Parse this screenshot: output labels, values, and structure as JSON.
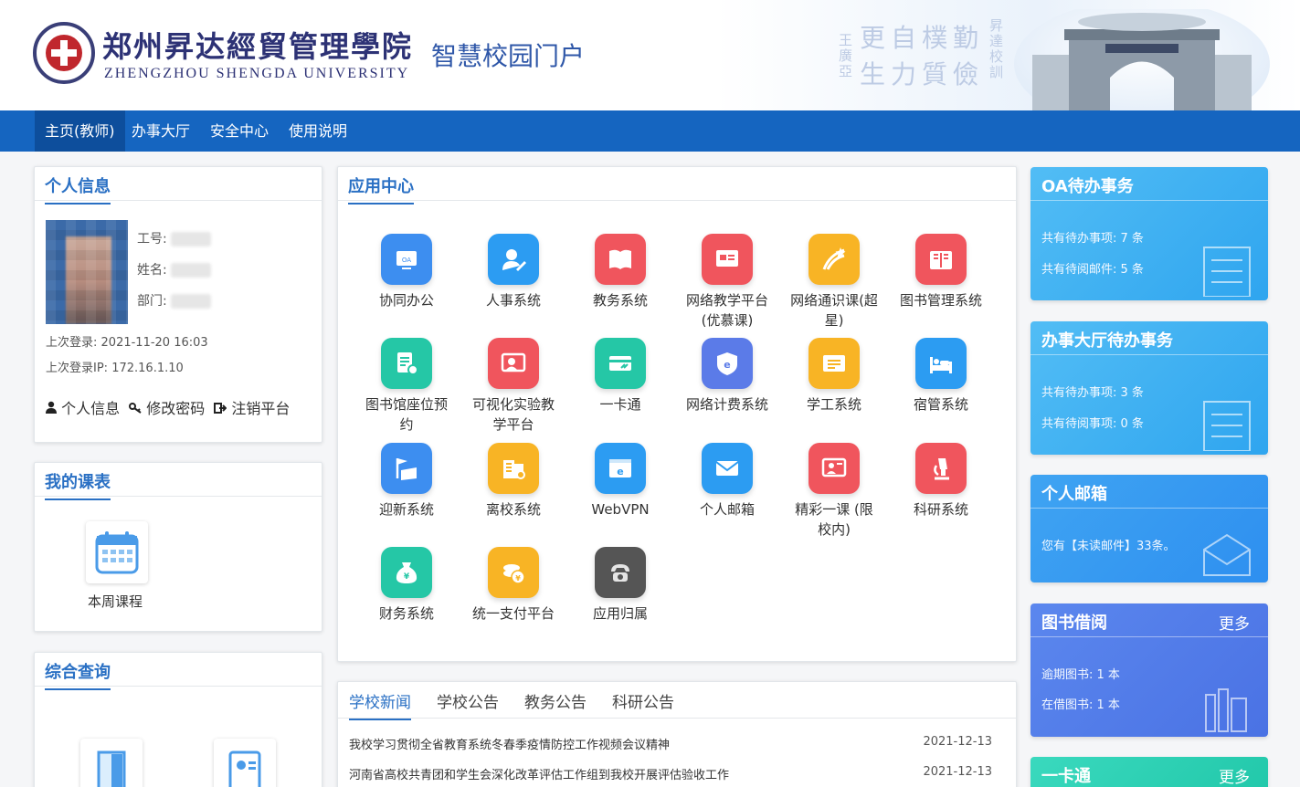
{
  "header": {
    "school_name_cn": "郑州昇达經貿管理學院",
    "school_name_en": "ZHENGZHOU SHENGDA UNIVERSITY",
    "portal_title": "智慧校园门户",
    "motto_main": "更自樸勤",
    "motto_sub": "生力質儉",
    "motto_side_left": "王廣亞",
    "motto_side_right": "昇達校訓"
  },
  "nav": {
    "items": [
      {
        "label": "主页(教师)",
        "active": true
      },
      {
        "label": "办事大厅",
        "active": false
      },
      {
        "label": "安全中心",
        "active": false
      },
      {
        "label": "使用说明",
        "active": false
      }
    ]
  },
  "personal": {
    "title": "个人信息",
    "fields": [
      {
        "label": "工号:"
      },
      {
        "label": "姓名:"
      },
      {
        "label": "部门:"
      }
    ],
    "last_login_label": "上次登录:",
    "last_login_value": "2021-11-20 16:03",
    "last_ip_label": "上次登录IP:",
    "last_ip_value": "172.16.1.10",
    "links": [
      "个人信息",
      "修改密码",
      "注销平台"
    ]
  },
  "schedule": {
    "title": "我的课表",
    "item_label": "本周课程"
  },
  "query": {
    "title": "综合查询"
  },
  "apps": {
    "title": "应用中心",
    "items": [
      {
        "label": "协同办公",
        "icon": "oa-icon",
        "color": "#3d8ef0"
      },
      {
        "label": "人事系统",
        "icon": "personnel-icon",
        "color": "#2c9cf2"
      },
      {
        "label": "教务系统",
        "icon": "book-icon",
        "color": "#f0555d"
      },
      {
        "label": "网络教学平台(优慕课)",
        "icon": "teaching-icon",
        "color": "#f0555d"
      },
      {
        "label": "网络通识课(超星)",
        "icon": "star-icon",
        "color": "#f8b425"
      },
      {
        "label": "图书管理系统",
        "icon": "library-icon",
        "color": "#f0555d"
      },
      {
        "label": "图书馆座位预约",
        "icon": "seat-icon",
        "color": "#25c7a6"
      },
      {
        "label": "可视化实验教学平台",
        "icon": "lab-screen-icon",
        "color": "#f0555d"
      },
      {
        "label": "一卡通",
        "icon": "card-icon",
        "color": "#25c7a6"
      },
      {
        "label": "网络计费系统",
        "icon": "billing-icon",
        "color": "#5b7be8"
      },
      {
        "label": "学工系统",
        "icon": "student-icon",
        "color": "#f8b425"
      },
      {
        "label": "宿管系统",
        "icon": "dorm-icon",
        "color": "#2c9cf2"
      },
      {
        "label": "迎新系统",
        "icon": "welcome-icon",
        "color": "#3d8ef0"
      },
      {
        "label": "离校系统",
        "icon": "leave-icon",
        "color": "#f8b425"
      },
      {
        "label": "WebVPN",
        "icon": "vpn-icon",
        "color": "#2c9cf2"
      },
      {
        "label": "个人邮箱",
        "icon": "mail-icon",
        "color": "#2c9cf2"
      },
      {
        "label": "精彩一课 (限校内)",
        "icon": "lesson-icon",
        "color": "#f0555d"
      },
      {
        "label": "科研系统",
        "icon": "microscope-icon",
        "color": "#f0555d"
      },
      {
        "label": "财务系统",
        "icon": "finance-icon",
        "color": "#25c7a6"
      },
      {
        "label": "统一支付平台",
        "icon": "payment-icon",
        "color": "#f8b425"
      },
      {
        "label": "应用归属",
        "icon": "phone-icon",
        "color": "#555555"
      }
    ]
  },
  "news": {
    "tabs": [
      "学校新闻",
      "学校公告",
      "教务公告",
      "科研公告"
    ],
    "items": [
      {
        "title": "我校学习贯彻全省教育系统冬春季疫情防控工作视频会议精神",
        "date": "2021-12-13"
      },
      {
        "title": "河南省高校共青团和学生会深化改革评估工作组到我校开展评估验收工作",
        "date": "2021-12-13"
      }
    ]
  },
  "cards": {
    "oa": {
      "title": "OA待办事务",
      "line1": "共有待办事项: 7 条",
      "line2": "共有待阅邮件: 5 条",
      "color": "#3fb0f2"
    },
    "hall": {
      "title": "办事大厅待办事务",
      "line1": "共有待办事项: 3 条",
      "line2": "共有待阅事项: 0 条",
      "color": "#3fb0f2"
    },
    "mail": {
      "title": "个人邮箱",
      "line1": "您有【未读邮件】33条。",
      "color": "#3a9cf0"
    },
    "books": {
      "title": "图书借阅",
      "more": "更多",
      "line1": "逾期图书: 1 本",
      "line2": "在借图书: 1 本",
      "color": "#4d7be8"
    },
    "card": {
      "title": "一卡通",
      "more": "更多",
      "color": "#2cd1b4"
    }
  }
}
